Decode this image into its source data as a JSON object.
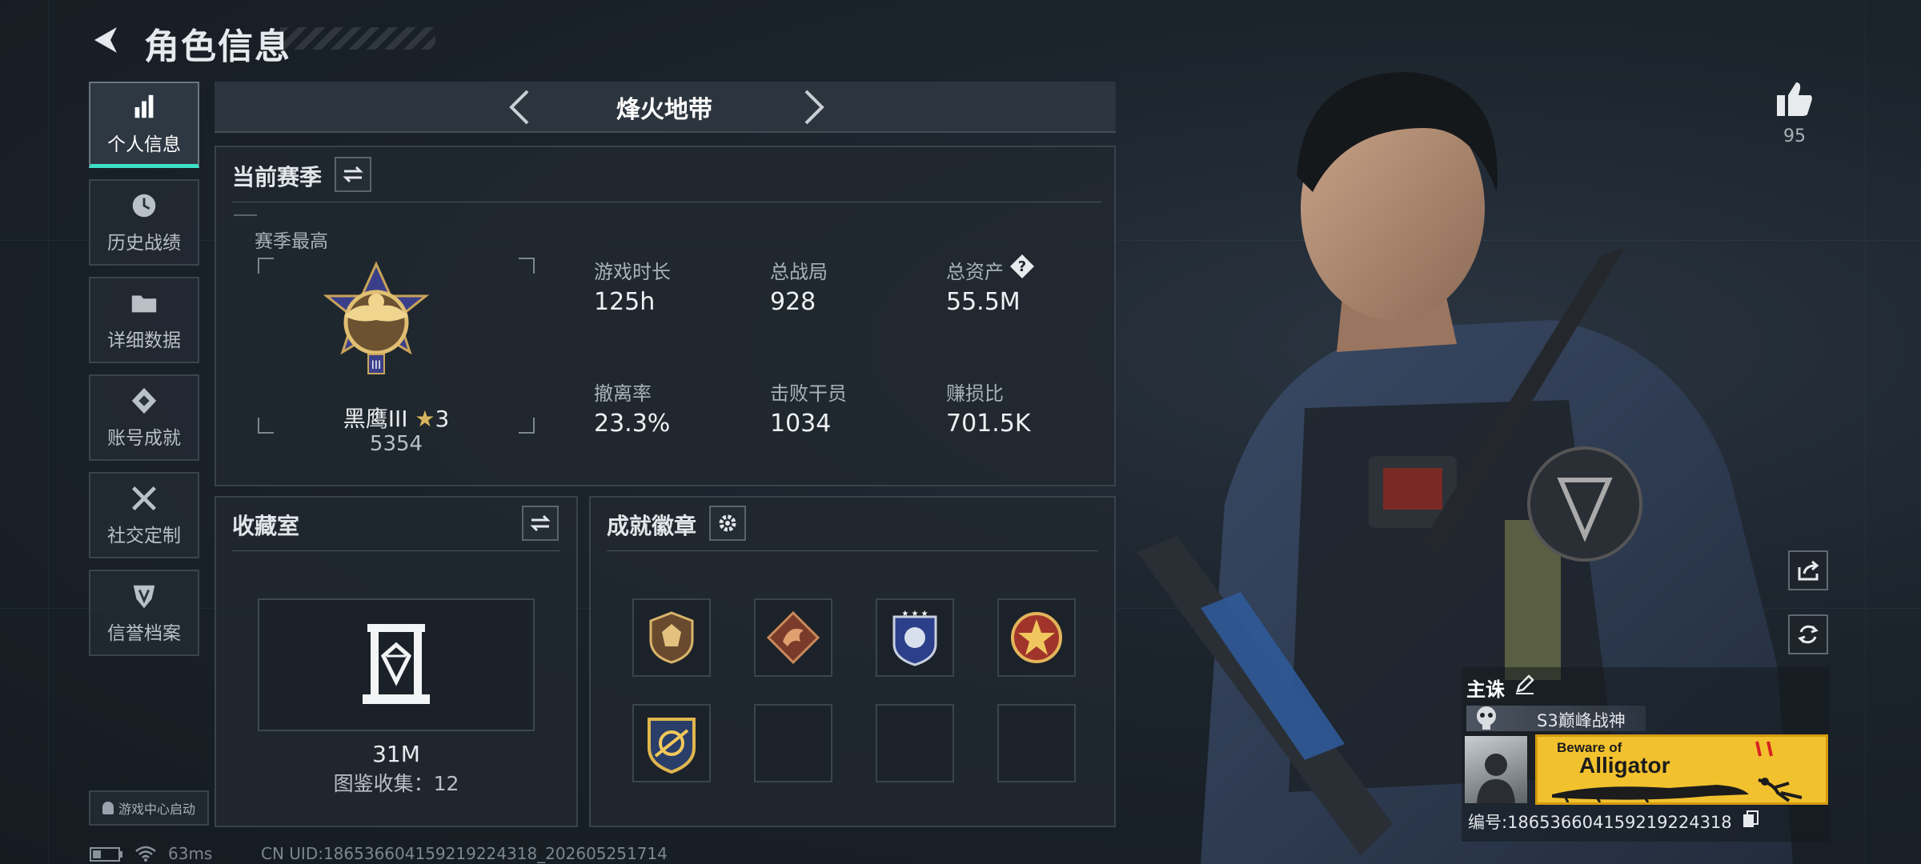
{
  "header": {
    "title": "角色信息"
  },
  "sidebar": {
    "items": [
      {
        "label": "个人信息",
        "icon": "bar-chart-icon"
      },
      {
        "label": "历史战绩",
        "icon": "history-clock-icon"
      },
      {
        "label": "详细数据",
        "icon": "folder-icon"
      },
      {
        "label": "账号成就",
        "icon": "achievement-icon"
      },
      {
        "label": "社交定制",
        "icon": "tools-icon"
      },
      {
        "label": "信誉档案",
        "icon": "shield-icon"
      }
    ],
    "launch_label": "游戏中心启动"
  },
  "mode_selector": {
    "label": "烽火地带"
  },
  "season": {
    "title": "当前赛季",
    "best_label": "赛季最高",
    "rank_name": "黑鹰III",
    "rank_stars": "3",
    "rank_points": "5354",
    "stats": [
      {
        "label": "游戏时长",
        "value": "125h"
      },
      {
        "label": "总战局",
        "value": "928"
      },
      {
        "label": "总资产",
        "value": "55.5M",
        "help": "?"
      },
      {
        "label": "撤离率",
        "value": "23.3%"
      },
      {
        "label": "击败干员",
        "value": "1034"
      },
      {
        "label": "赚损比",
        "value": "701.5K"
      }
    ]
  },
  "collection": {
    "title": "收藏室",
    "value": "31M",
    "catalog_text": "图鉴收集：12"
  },
  "badges": {
    "title": "成就徽章"
  },
  "likes": {
    "count": "95"
  },
  "player_card": {
    "weapon_label": "主诛",
    "title_text": "S3巅峰战神",
    "banner_line1": "Beware of",
    "banner_line2": "Alligator",
    "id_text": "编号:18653660415921922431​8"
  },
  "status_bar": {
    "ping": "63ms",
    "uid": "CN UID:18653660415921922431​8_202605251714"
  },
  "colors": {
    "accent": "#3ee0c8",
    "panel_border": "#39424b",
    "banner": "#f2c12e"
  }
}
